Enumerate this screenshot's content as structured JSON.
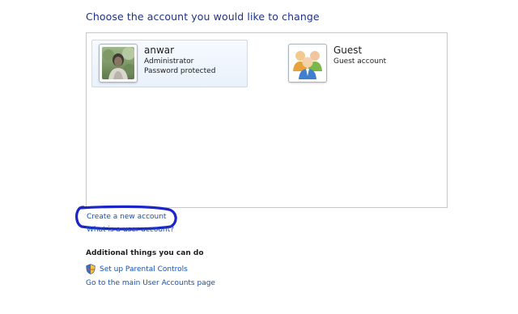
{
  "heading": "Choose the account you would like to change",
  "accounts": [
    {
      "name": "anwar",
      "role": "Administrator",
      "status": "Password protected",
      "avatar_icon": "user-photo-icon"
    },
    {
      "name": "Guest",
      "role": "Guest account",
      "avatar_icon": "guest-users-icon"
    }
  ],
  "links": {
    "create_account": "Create a new account",
    "what_is_user_account": "What is a user account?"
  },
  "additional": {
    "title": "Additional things you can do",
    "parental_controls": "Set up Parental Controls",
    "main_page": "Go to the main User Accounts page"
  },
  "colors": {
    "heading": "#1e3287",
    "link": "#1550b4",
    "annotation": "#1a24c8"
  }
}
